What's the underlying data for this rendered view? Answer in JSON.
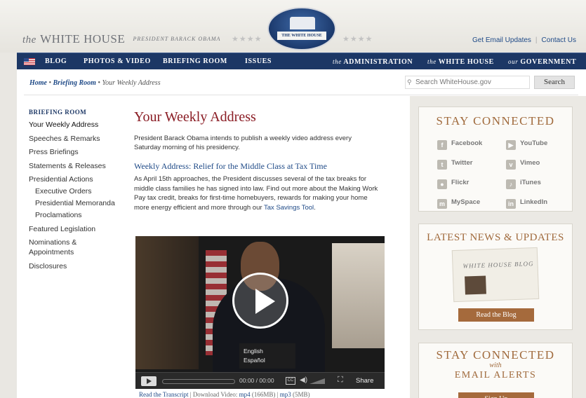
{
  "header": {
    "brand_the": "the",
    "brand_name": "WHITE HOUSE",
    "brand_sub": "PRESIDENT BARACK OBAMA",
    "seal_text": "THE WHITE HOUSE",
    "get_email": "Get Email Updates",
    "contact": "Contact Us"
  },
  "nav": {
    "blog": "BLOG",
    "photos": "PHOTOS & VIDEO",
    "briefing": "BRIEFING ROOM",
    "issues": "ISSUES",
    "admin_prefix": "the",
    "admin": "ADMINISTRATION",
    "wh_prefix": "the",
    "wh": "WHITE HOUSE",
    "gov_prefix": "our",
    "gov": "GOVERNMENT"
  },
  "breadcrumb": {
    "home": "Home",
    "briefing": "Briefing Room",
    "current": "Your Weekly Address"
  },
  "search": {
    "placeholder": "Search WhiteHouse.gov",
    "button": "Search"
  },
  "leftnav": {
    "heading": "BRIEFING ROOM",
    "items": [
      "Your Weekly Address",
      "Speeches & Remarks",
      "Press Briefings",
      "Statements & Releases",
      "Presidential Actions",
      "Executive Orders",
      "Presidential Memoranda",
      "Proclamations",
      "Featured Legislation",
      "Nominations & Appointments",
      "Disclosures"
    ]
  },
  "main": {
    "title": "Your Weekly Address",
    "intro": "President Barack Obama intends to publish a weekly video address every Saturday morning of his presidency.",
    "subtitle": "Weekly Address: Relief for the Middle Class at Tax Time",
    "body": "As April 15th approaches, the President discusses several of the tax breaks for middle class families he has signed into law.  Find out more about the Making Work Pay tax credit, breaks for first-time homebuyers, rewards for making your home more energy efficient and more through our",
    "link": "Tax Savings Tool",
    "period": "."
  },
  "video": {
    "lang1": "English",
    "lang2": "Español",
    "time": "00:00 / 00:00",
    "cc": "CC",
    "share": "Share"
  },
  "video_links": {
    "transcript": "Read the Transcript",
    "download": "Download Video:",
    "mp4": "mp4",
    "mp4_size": "(166MB)",
    "mp3": "mp3",
    "mp3_size": "(5MB)"
  },
  "sidebar": {
    "connect_title": "STAY CONNECTED",
    "social": [
      "Facebook",
      "YouTube",
      "Twitter",
      "Vimeo",
      "Flickr",
      "iTunes",
      "MySpace",
      "LinkedIn"
    ],
    "news_title": "LATEST NEWS & UPDATES",
    "blog_paper": "WHITE HOUSE BLOG",
    "read_blog": "Read the Blog",
    "email_title": "STAY CONNECTED",
    "email_with": "with",
    "email_title2": "EMAIL ALERTS",
    "signup": "Sign Up"
  }
}
